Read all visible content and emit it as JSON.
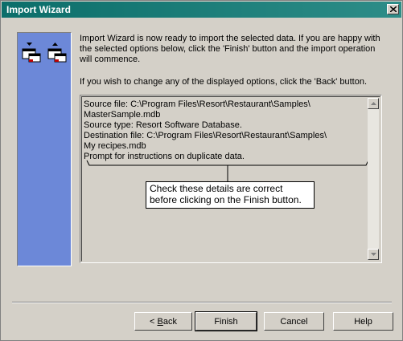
{
  "window": {
    "title": "Import Wizard"
  },
  "intro": {
    "paragraph1": "Import Wizard is now ready to import the selected data.  If you are happy with the selected options below, click the 'Finish' button and the import operation will commence.",
    "paragraph2": "If you wish to change any of the displayed options, click the 'Back' button."
  },
  "details": {
    "lines": [
      "Source file: C:\\Program Files\\Resort\\Restaurant\\Samples\\",
      "MasterSample.mdb",
      "Source type: Resort Software Database.",
      "Destination file: C:\\Program Files\\Resort\\Restaurant\\Samples\\",
      "My recipes.mdb",
      "Prompt for instructions on duplicate data."
    ]
  },
  "callout": {
    "line1": "Check these details are correct",
    "line2": "before clicking on the Finish button."
  },
  "buttons": {
    "back_prefix": "< ",
    "back_key": "B",
    "back_rest": "ack",
    "finish": "Finish",
    "cancel": "Cancel",
    "help": "Help"
  },
  "icons": {
    "close": "close-icon",
    "import": "import-icon",
    "export": "export-icon"
  }
}
